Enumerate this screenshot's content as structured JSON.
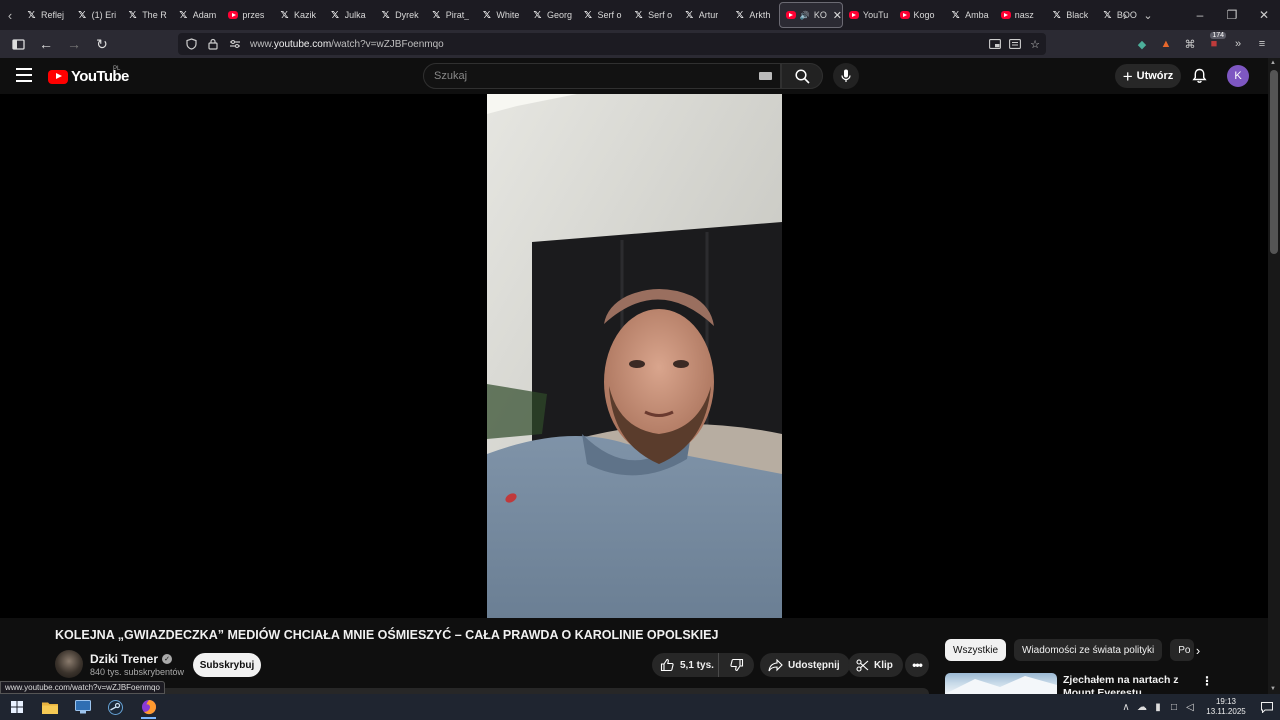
{
  "browser": {
    "tabs": [
      {
        "label": "Reflej",
        "icon": "x-logo-icon"
      },
      {
        "label": "(1) Eri",
        "icon": "x-logo-icon"
      },
      {
        "label": "The R",
        "icon": "x-logo-icon"
      },
      {
        "label": "Adam",
        "icon": "x-logo-icon"
      },
      {
        "label": "przes",
        "icon": "youtube-icon"
      },
      {
        "label": "Kazik",
        "icon": "x-logo-icon"
      },
      {
        "label": "Julka",
        "icon": "x-logo-icon"
      },
      {
        "label": "Dyrek",
        "icon": "x-logo-icon"
      },
      {
        "label": "Pirat_",
        "icon": "x-logo-icon"
      },
      {
        "label": "White",
        "icon": "x-logo-icon"
      },
      {
        "label": "Georg",
        "icon": "x-logo-icon"
      },
      {
        "label": "Serf o",
        "icon": "x-logo-icon"
      },
      {
        "label": "Serf o",
        "icon": "x-logo-icon"
      },
      {
        "label": "Artur",
        "icon": "x-logo-icon"
      },
      {
        "label": "Arkth",
        "icon": "x-logo-icon"
      },
      {
        "label": "KO",
        "icon": "youtube-icon",
        "active": true,
        "audio": true
      },
      {
        "label": "YouTu",
        "icon": "youtube-icon"
      },
      {
        "label": "Kogo",
        "icon": "youtube-icon"
      },
      {
        "label": "Amba",
        "icon": "x-logo-icon"
      },
      {
        "label": "nasz",
        "icon": "youtube-icon"
      },
      {
        "label": "Black",
        "icon": "x-logo-icon"
      },
      {
        "label": "BOO",
        "icon": "x-logo-icon"
      }
    ],
    "url_prefix": "www.",
    "url_domain": "youtube.com",
    "url_path": "/watch?v=wZJBFoenmqo",
    "extension_badge": "174",
    "status_url": "www.youtube.com/watch?v=wZJBFoenmqo"
  },
  "youtube": {
    "logo_text": "YouTube",
    "country_code": "PL",
    "search_placeholder": "Szukaj",
    "create_label": "Utwórz",
    "avatar_letter": "K"
  },
  "video": {
    "title": "KOLEJNA „GWIAZDECZKA” MEDIÓW CHCIAŁA MNIE OŚMIESZYĆ – CAŁA PRAWDA O KAROLINIE OPOLSKIEJ",
    "channel_name": "Dziki Trener",
    "subscribers": "840 tys. subskrybentów",
    "subscribe_label": "Subskrybuj",
    "likes": "5,1 tys.",
    "share_label": "Udostępnij",
    "clip_label": "Klip"
  },
  "sidebar": {
    "chips": [
      "Wszystkie",
      "Wiadomości ze świata polityki",
      "Po"
    ],
    "recommended_title": "Zjechałem na nartach z Mount Everestu"
  },
  "taskbar": {
    "time": "19:13",
    "date": "13.11.2025"
  },
  "colors": {
    "youtube_red": "#ff0000",
    "avatar_purple": "#7e57c2",
    "page_bg": "#0f0f0f"
  }
}
